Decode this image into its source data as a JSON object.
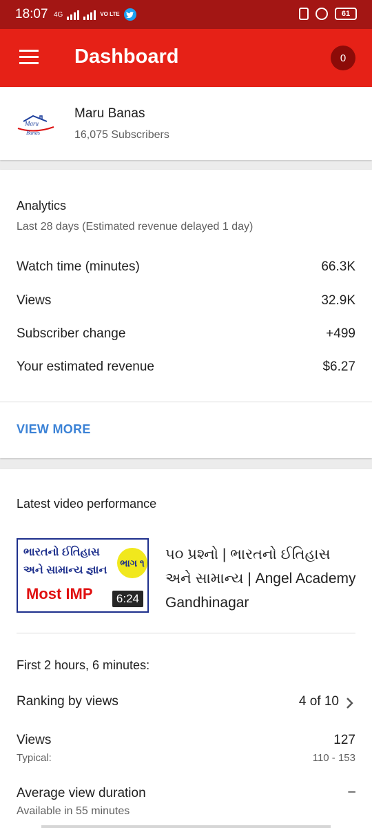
{
  "status_bar": {
    "time": "18:07",
    "network": "4G",
    "volte": "VO LTE",
    "battery": "61"
  },
  "app_bar": {
    "title": "Dashboard",
    "notification_count": "0"
  },
  "channel": {
    "name": "Maru Banas",
    "subscribers": "16,075 Subscribers",
    "logo_text_top": "Maru",
    "logo_text_bottom": "Banas"
  },
  "analytics": {
    "title": "Analytics",
    "subtitle": "Last 28 days (Estimated revenue delayed 1 day)",
    "metrics": [
      {
        "label": "Watch time (minutes)",
        "value": "66.3K"
      },
      {
        "label": "Views",
        "value": "32.9K"
      },
      {
        "label": "Subscriber change",
        "value": "+499"
      },
      {
        "label": "Your estimated revenue",
        "value": "$6.27"
      }
    ],
    "view_more": "VIEW MORE"
  },
  "latest_video": {
    "title": "Latest video performance",
    "thumbnail": {
      "line1": "ભારતનો ઈતિહાસ",
      "line2": "અને સામાન્ય જ્ઞાન",
      "badge": "ભાગ ૧",
      "highlight": "Most IMP",
      "duration": "6:24"
    },
    "video_title": "૫૦ પ્રશ્નો | ભારતનો ઈતિહાસ અને સામાન્ય | Angel Academy Gandhinagar",
    "period": "First 2 hours, 6 minutes:",
    "ranking_label": "Ranking by views",
    "ranking_value": "4 of 10",
    "views_label": "Views",
    "views_value": "127",
    "typical_label": "Typical:",
    "typical_value": "110 - 153",
    "avg_duration_label": "Average view duration",
    "avg_duration_value": "–",
    "avg_duration_note": "Available in 55 minutes"
  },
  "colors": {
    "status_bar": "#a31614",
    "app_bar": "#e62117",
    "link": "#3b82d6"
  }
}
